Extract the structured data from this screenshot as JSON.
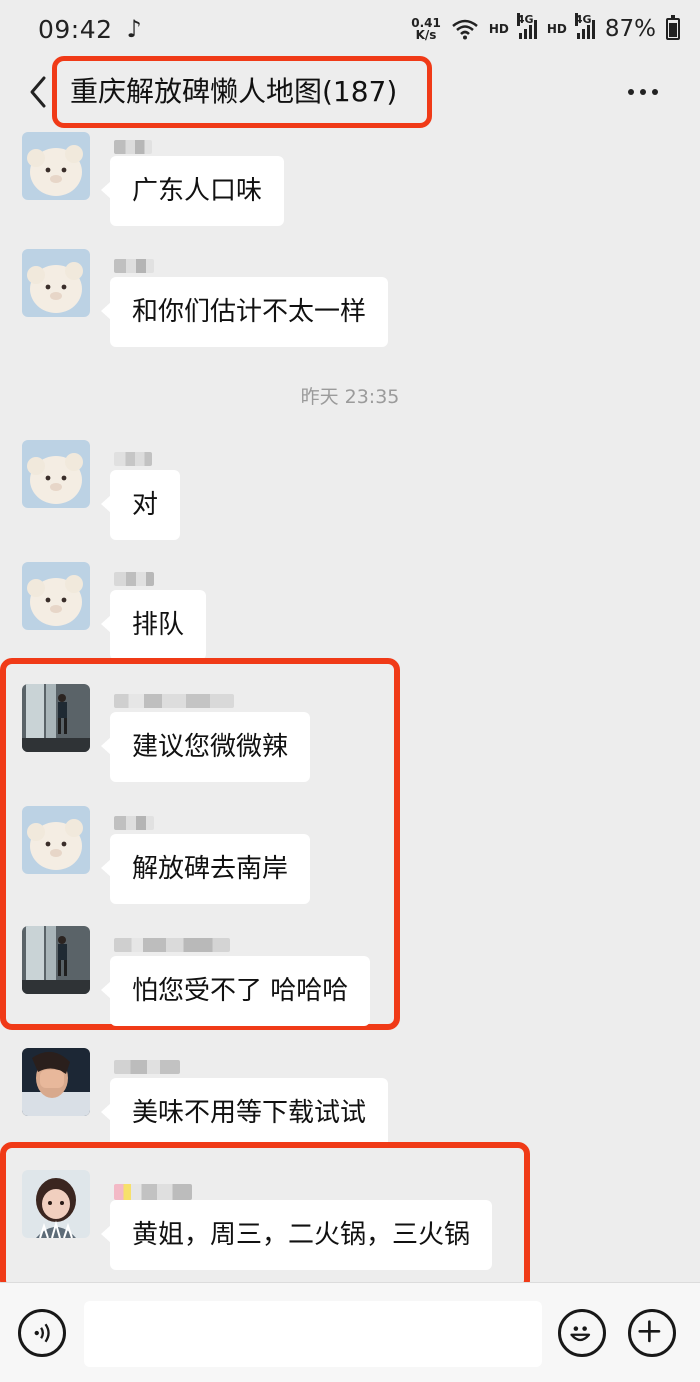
{
  "status_bar": {
    "time": "09:42",
    "net_speed_value": "0.41",
    "net_speed_unit": "K/s",
    "hd_1": "HD",
    "net_1": "4G",
    "hd_2": "HD",
    "net_2": "4G",
    "battery": "87%",
    "icons": [
      "music-note-icon",
      "wifi-icon",
      "signal-icon",
      "battery-icon"
    ]
  },
  "header": {
    "title": "重庆解放碑懒人地图(187)",
    "icons": [
      "chevron-left-icon",
      "more-icon"
    ]
  },
  "chat": {
    "timestamp": "昨天 23:35",
    "messages": [
      {
        "text": "广东人口味",
        "avatar": "sheep-avatar"
      },
      {
        "text": "和你们估计不太一样",
        "avatar": "sheep-avatar"
      },
      {
        "text": "对",
        "avatar": "sheep-avatar"
      },
      {
        "text": "排队",
        "avatar": "sheep-avatar"
      },
      {
        "text": "建议您微微辣",
        "avatar": "waterfall-person-avatar"
      },
      {
        "text": "解放碑去南岸",
        "avatar": "sheep-avatar"
      },
      {
        "text": "怕您受不了 哈哈哈",
        "avatar": "waterfall-person-avatar"
      },
      {
        "text": "美味不用等下载试试",
        "avatar": "face-cover-avatar"
      },
      {
        "text": "黄姐，周三，二火锅，三火锅",
        "avatar": "child-avatar"
      }
    ],
    "annotation_color": "#f03a17"
  },
  "input_bar": {
    "placeholder": "",
    "icons": [
      "voice-icon",
      "emoji-icon",
      "plus-icon"
    ]
  }
}
